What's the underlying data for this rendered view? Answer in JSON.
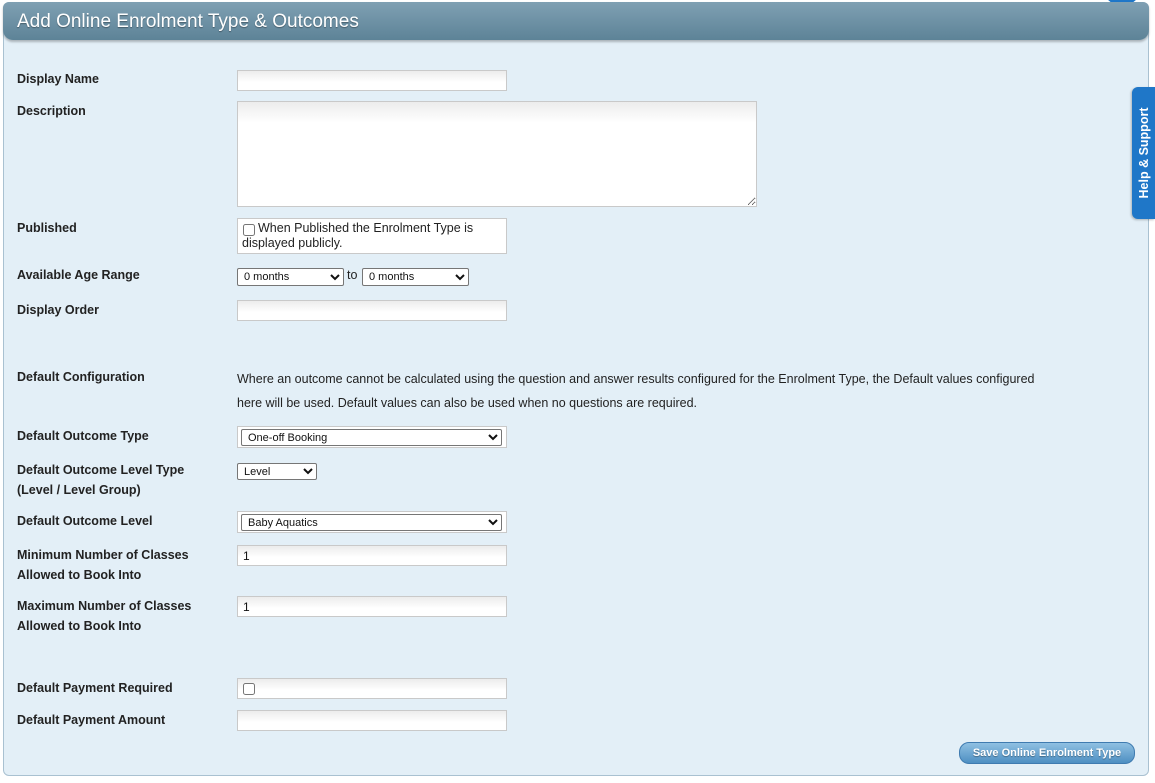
{
  "header": {
    "title": "Add Online Enrolment Type & Outcomes"
  },
  "help_tab": {
    "label": "Help & Support"
  },
  "form": {
    "display_name": {
      "label": "Display Name",
      "value": ""
    },
    "description": {
      "label": "Description",
      "value": ""
    },
    "published": {
      "label": "Published",
      "checkbox_text": "When Published the Enrolment Type is displayed publicly.",
      "checked": false
    },
    "age_range": {
      "label": "Available Age Range",
      "from_value": "0 months",
      "to_text": "to",
      "to_value": "0 months"
    },
    "display_order": {
      "label": "Display Order",
      "value": ""
    },
    "default_configuration": {
      "label": "Default Configuration",
      "description": "Where an outcome cannot be calculated using the question and answer results configured for the Enrolment Type, the Default values configured here will be used. Default values can also be used when no questions are required."
    },
    "default_outcome_type": {
      "label": "Default Outcome Type",
      "value": "One-off Booking"
    },
    "default_outcome_level_type": {
      "label_line1": "Default Outcome Level Type",
      "label_line2": "(Level / Level Group)",
      "value": "Level"
    },
    "default_outcome_level": {
      "label": "Default Outcome Level",
      "value": "Baby Aquatics"
    },
    "min_classes": {
      "label_line1": "Minimum Number of Classes",
      "label_line2": "Allowed to Book Into",
      "value": "1"
    },
    "max_classes": {
      "label_line1": "Maximum Number of Classes",
      "label_line2": "Allowed to Book Into",
      "value": "1"
    },
    "default_payment_required": {
      "label": "Default Payment Required",
      "checked": false
    },
    "default_payment_amount": {
      "label": "Default Payment Amount",
      "value": ""
    }
  },
  "actions": {
    "save_label": "Save Online Enrolment Type"
  },
  "colors": {
    "header": "#6a8ea2",
    "panel": "#e3eff7",
    "accent": "#1f77c8"
  }
}
